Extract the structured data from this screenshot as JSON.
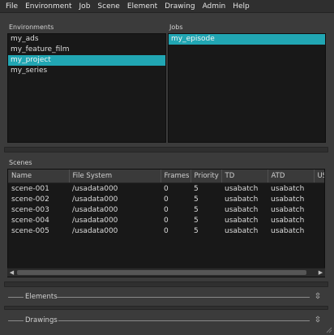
{
  "menubar": {
    "items": [
      "File",
      "Environment",
      "Job",
      "Scene",
      "Element",
      "Drawing",
      "Admin",
      "Help"
    ]
  },
  "environments": {
    "label": "Environments",
    "items": [
      "my_ads",
      "my_feature_film",
      "my_project",
      "my_series"
    ],
    "selected": "my_project"
  },
  "jobs": {
    "label": "Jobs",
    "items": [
      "my_episode"
    ],
    "selected": "my_episode"
  },
  "scenes": {
    "label": "Scenes",
    "columns": [
      "Name",
      "File System",
      "Frames",
      "Priority",
      "TD",
      "ATD",
      "USE"
    ],
    "rows": [
      [
        "scene-001",
        "/usadata000",
        "0",
        "5",
        "usabatch",
        "usabatch",
        ""
      ],
      [
        "scene-002",
        "/usadata000",
        "0",
        "5",
        "usabatch",
        "usabatch",
        ""
      ],
      [
        "scene-003",
        "/usadata000",
        "0",
        "5",
        "usabatch",
        "usabatch",
        ""
      ],
      [
        "scene-004",
        "/usadata000",
        "0",
        "5",
        "usabatch",
        "usabatch",
        ""
      ],
      [
        "scene-005",
        "/usadata000",
        "0",
        "5",
        "usabatch",
        "usabatch",
        ""
      ]
    ]
  },
  "elements": {
    "label": "Elements",
    "handle_icon": "drag-handle-icon"
  },
  "drawings": {
    "label": "Drawings",
    "handle_icon": "drag-handle-icon"
  },
  "colors": {
    "selection": "#21a6b3",
    "background": "#3b3b3b",
    "list_background": "#181818"
  }
}
